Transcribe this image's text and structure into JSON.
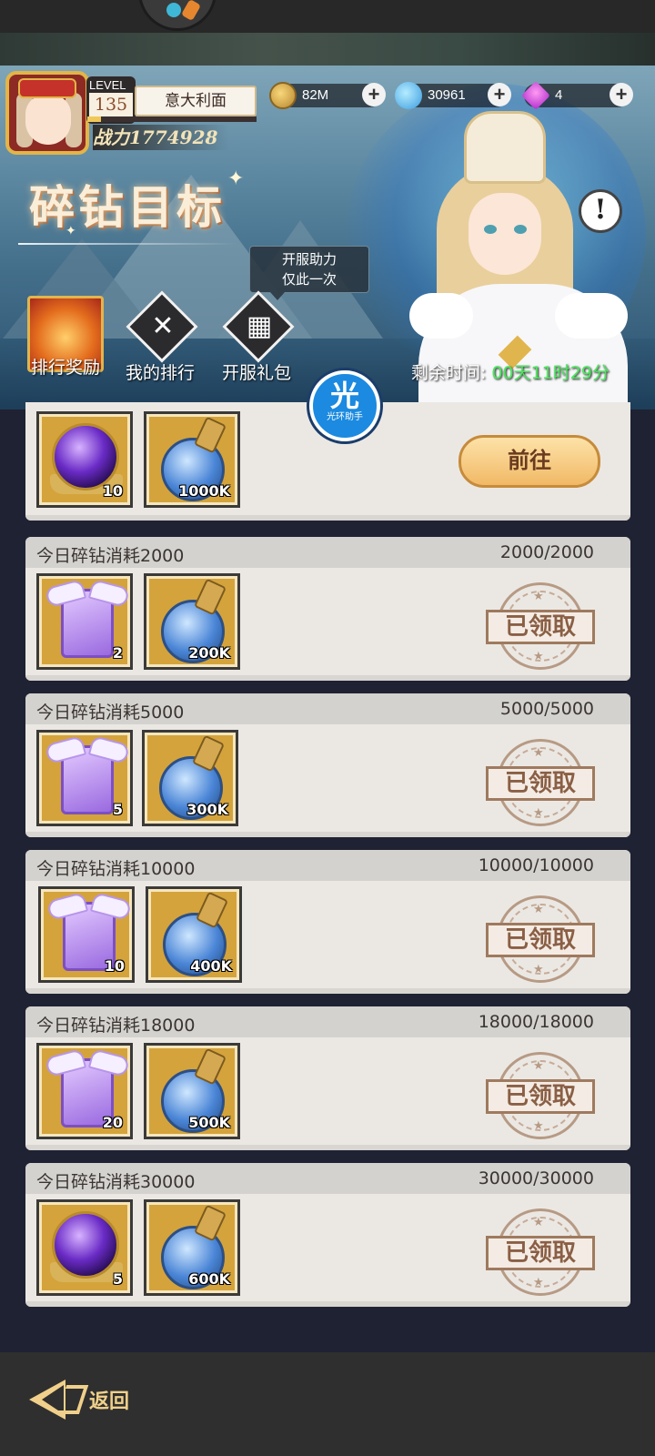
{
  "player": {
    "level_label": "LEVEL",
    "level": "135",
    "name": "意大利面",
    "power_label": "战力",
    "power": "1774928",
    "exp_progress": 0.08
  },
  "currencies": [
    {
      "name": "gold-coin",
      "value": "82M"
    },
    {
      "name": "crystal",
      "value": "30961"
    },
    {
      "name": "gem",
      "value": "4"
    }
  ],
  "event": {
    "title": "碎钻目标",
    "tooltip_line1": "开服助力",
    "tooltip_line2": "仅此一次",
    "shortcuts": [
      {
        "label": "排行奖励",
        "icon": "phoenix-icon"
      },
      {
        "label": "我的排行",
        "icon": "crossed-swords-icon"
      },
      {
        "label": "开服礼包",
        "icon": "gift-icon"
      }
    ],
    "timer_label": "剩余时间:",
    "timer_value": "00天11时29分",
    "info_symbol": "!"
  },
  "assistant": {
    "big": "光",
    "small": "光环助手"
  },
  "first_task": {
    "items": [
      {
        "icon": "purple-orb-icon",
        "qty": "10"
      },
      {
        "icon": "blue-potion-icon",
        "qty": "1000K"
      }
    ],
    "button": "前往"
  },
  "tasks": [
    {
      "name": "今日碎钻消耗2000",
      "progress": "2000/2000",
      "items": [
        {
          "icon": "winged-card-icon",
          "qty": "2"
        },
        {
          "icon": "blue-potion-icon",
          "qty": "200K"
        }
      ],
      "status": "已领取"
    },
    {
      "name": "今日碎钻消耗5000",
      "progress": "5000/5000",
      "items": [
        {
          "icon": "winged-card-icon",
          "qty": "5"
        },
        {
          "icon": "blue-potion-icon",
          "qty": "300K"
        }
      ],
      "status": "已领取"
    },
    {
      "name": "今日碎钻消耗10000",
      "progress": "10000/10000",
      "items": [
        {
          "icon": "winged-card-icon",
          "qty": "10"
        },
        {
          "icon": "blue-potion-icon",
          "qty": "400K"
        }
      ],
      "status": "已领取"
    },
    {
      "name": "今日碎钻消耗18000",
      "progress": "18000/18000",
      "items": [
        {
          "icon": "winged-card-icon",
          "qty": "20"
        },
        {
          "icon": "blue-potion-icon",
          "qty": "500K"
        }
      ],
      "status": "已领取"
    },
    {
      "name": "今日碎钻消耗30000",
      "progress": "30000/30000",
      "items": [
        {
          "icon": "purple-orb-icon",
          "qty": "5"
        },
        {
          "icon": "blue-potion-icon",
          "qty": "600K"
        }
      ],
      "status": "已领取"
    }
  ],
  "footer": {
    "back_label": "返回"
  }
}
